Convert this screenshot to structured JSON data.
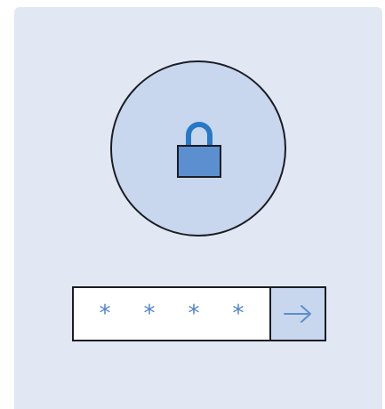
{
  "lock_screen": {
    "icon": "lock-icon",
    "password": {
      "masked_chars": [
        "*",
        "*",
        "*",
        "*"
      ],
      "char_color": "#4f84cf"
    },
    "submit": {
      "icon": "arrow-right-icon"
    }
  },
  "colors": {
    "card_background": "#e1e8f4",
    "circle_fill": "#c8d7ee",
    "lock_body": "#5b8fd0",
    "lock_shackle": "#2778c6",
    "outline": "#1b1d23",
    "button_fill": "#c8d7ee",
    "arrow": "#5b8fd0"
  }
}
